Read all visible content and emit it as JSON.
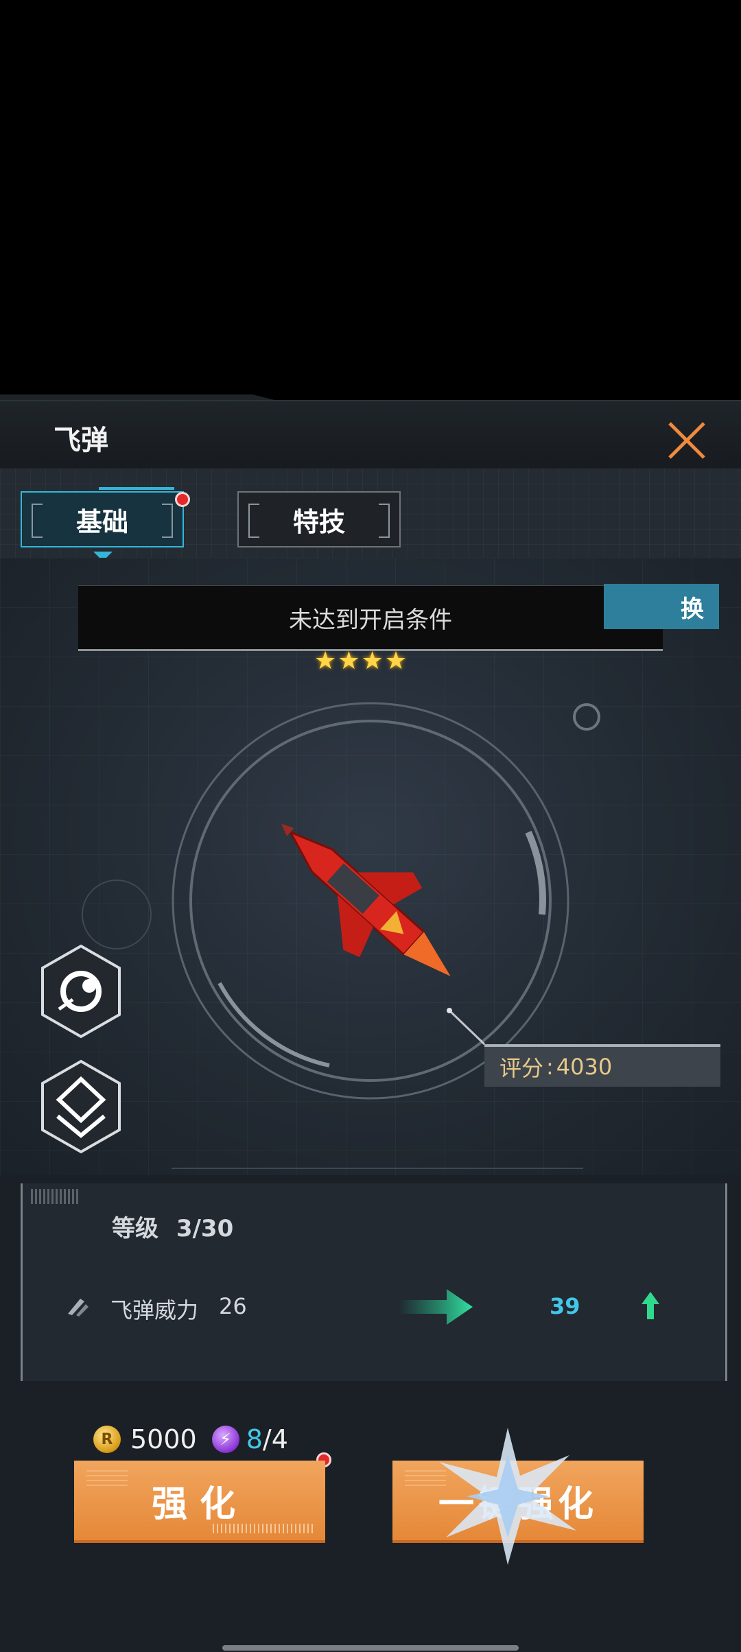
{
  "header": {
    "title": "飞弹",
    "close_icon": "close-icon"
  },
  "tabs": [
    {
      "label": "基础",
      "active": true,
      "has_badge": true
    },
    {
      "label": "特技",
      "active": false,
      "has_badge": false
    }
  ],
  "stage": {
    "banner_text": "未达到开启条件",
    "swap_button": "换",
    "stars": "★★★★",
    "star_count": 4,
    "score_label": "评分",
    "score_sep": ":",
    "score_value": "4030",
    "side_icons": [
      "skill-swirl-icon",
      "rank-chevron-icon"
    ]
  },
  "stats": {
    "level_label": "等级",
    "level_value": "3/30",
    "power_label": "飞弹威力",
    "power_current": "26",
    "power_next": "39"
  },
  "cost": {
    "coin_icon_letter": "R",
    "coin_amount": "5000",
    "energy_current": "8",
    "energy_sep": "/4",
    "has_badge": true
  },
  "buttons": {
    "strengthen": "强化",
    "one_key": "一键强化"
  },
  "colors": {
    "accent_cyan": "#35b6d8",
    "button_orange": "#e58838",
    "score_gold": "#e7c98a"
  }
}
